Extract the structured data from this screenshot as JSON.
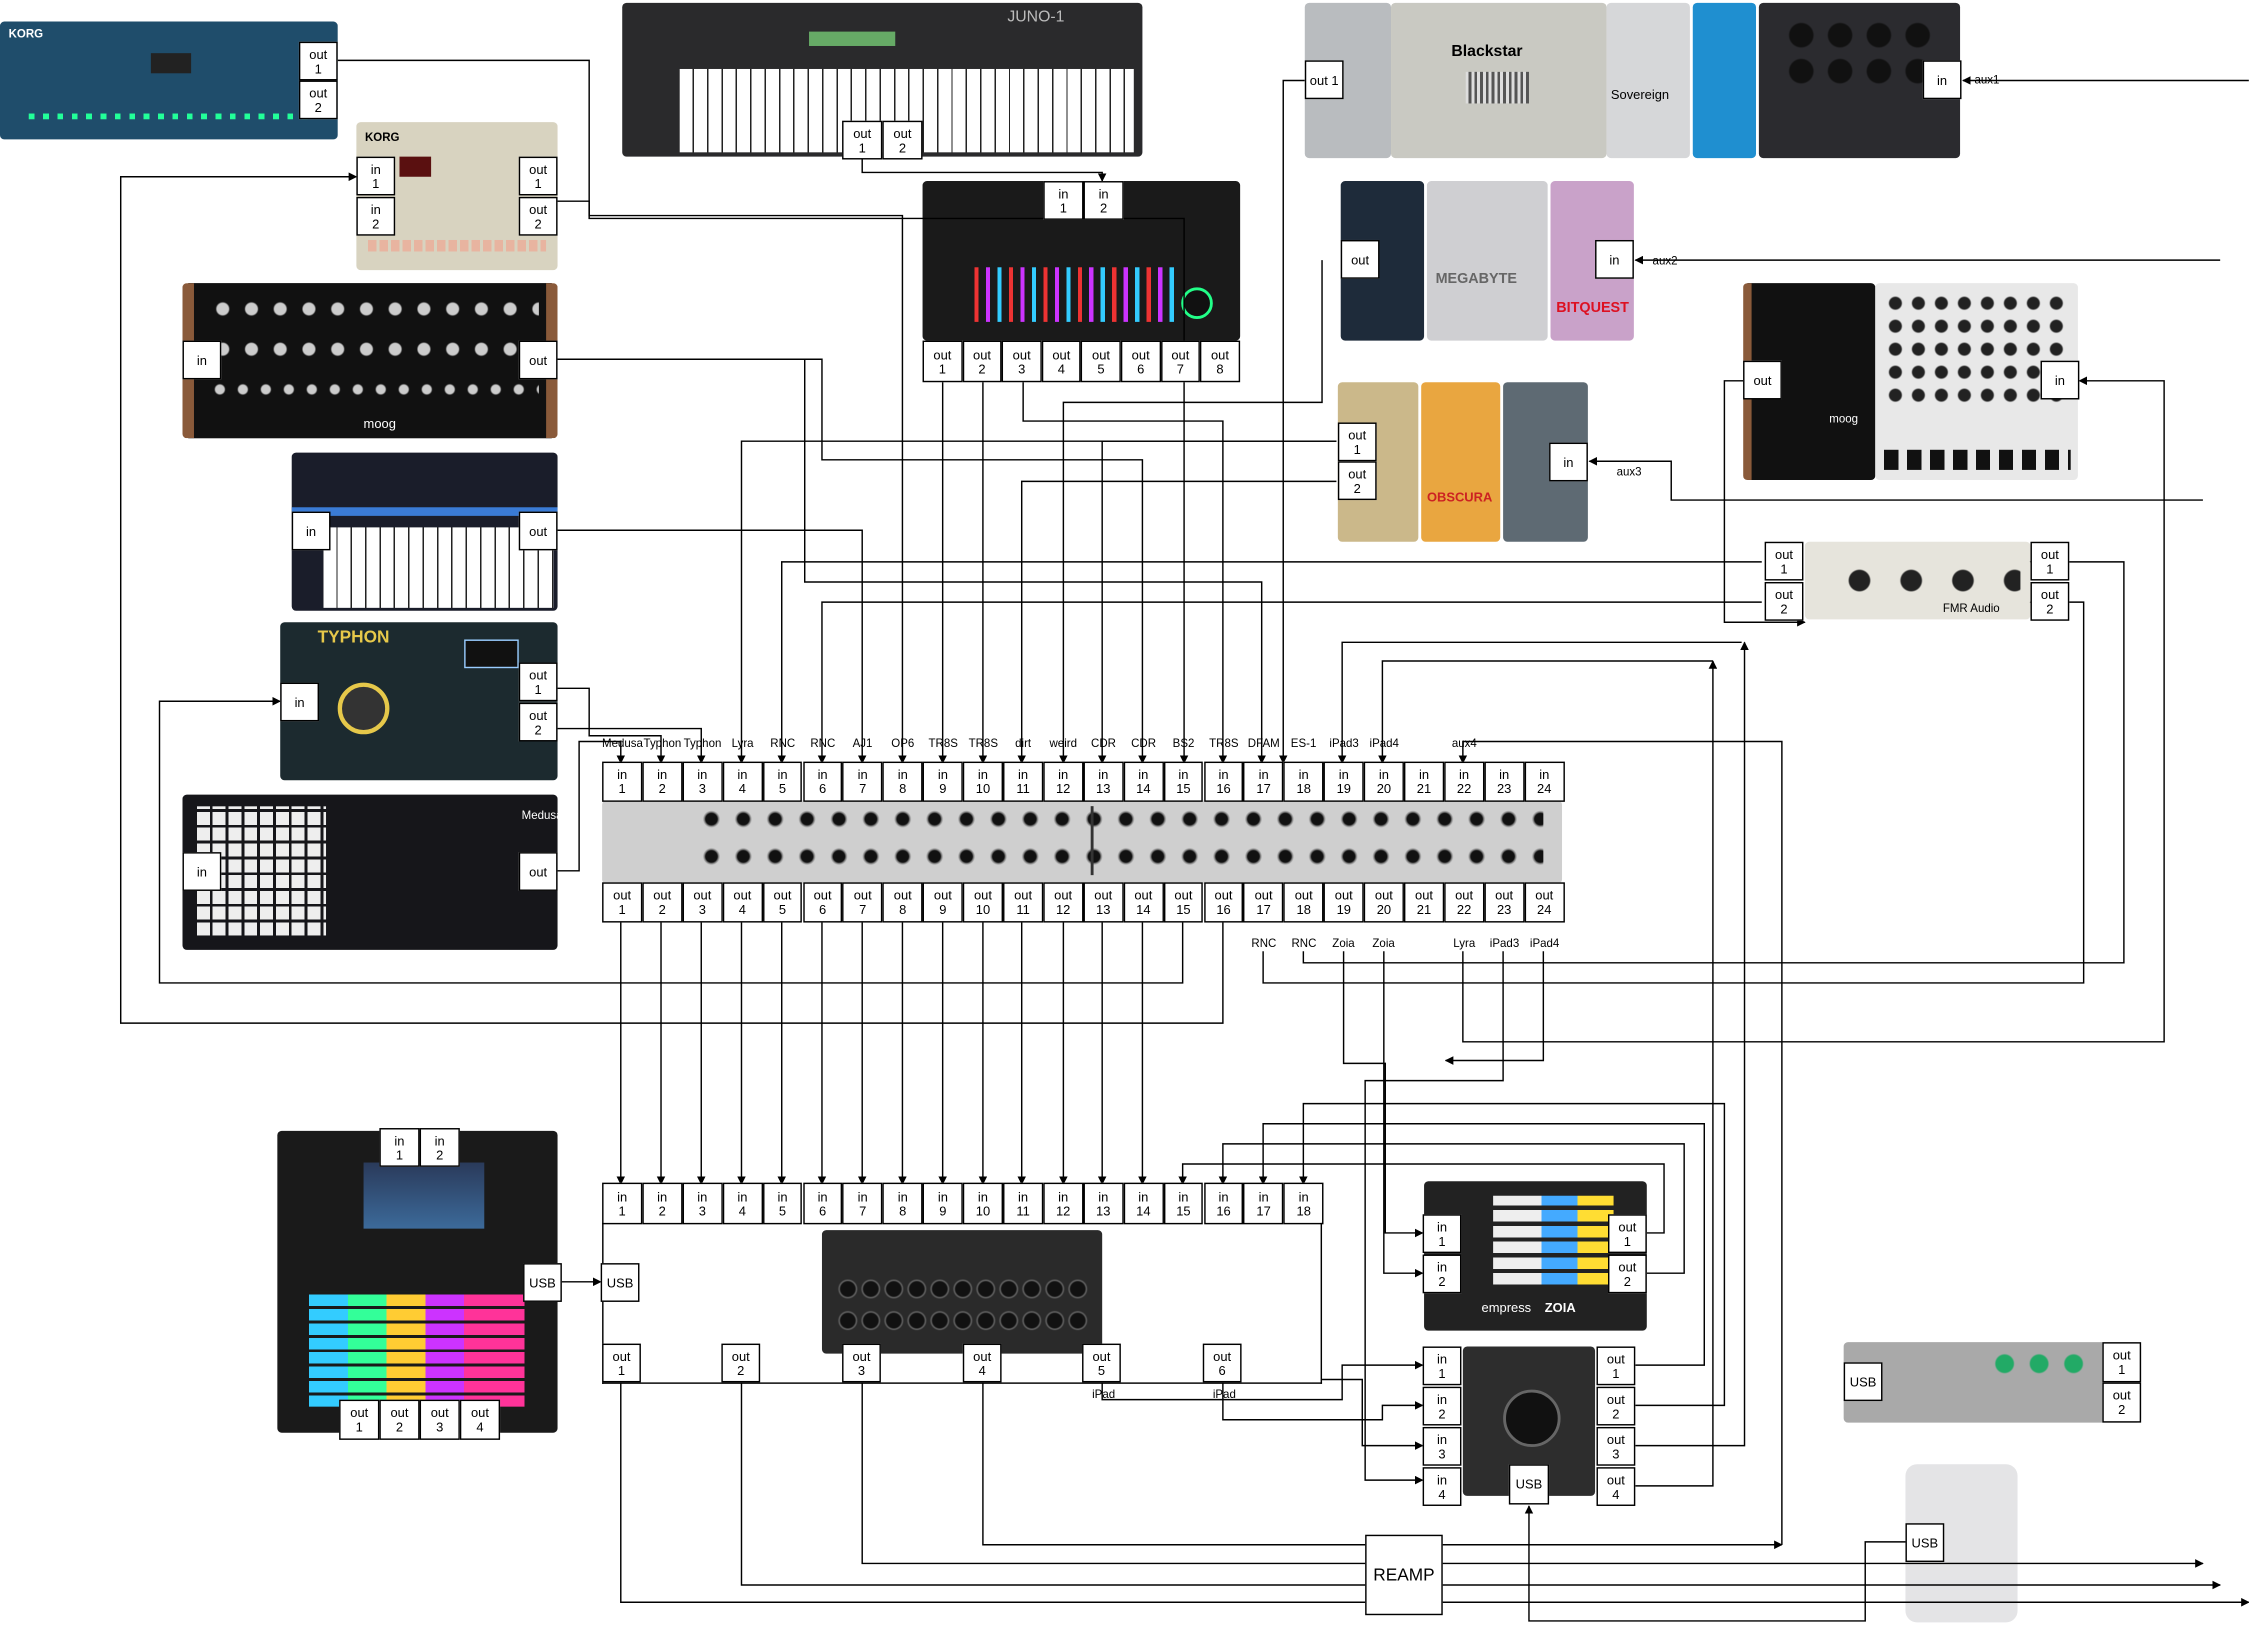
{
  "patchbay_top_labels": [
    "Medusa",
    "Typhon",
    "Typhon",
    "Lyra",
    "RNC",
    "RNC",
    "AJ1",
    "OP6",
    "TR8S",
    "TR8S",
    "dirt",
    "weird",
    "CDR",
    "CDR",
    "BS2",
    "TR8S",
    "DFAM",
    "ES-1",
    "iPad3",
    "iPad4",
    "",
    "aux4",
    "",
    ""
  ],
  "patchbay_bottom_labels": [
    "",
    "",
    "",
    "",
    "",
    "",
    "",
    "",
    "",
    "",
    "",
    "",
    "",
    "",
    "",
    "",
    "RNC",
    "RNC",
    "Zoia",
    "Zoia",
    "",
    "Lyra",
    "iPad3",
    "iPad4"
  ],
  "patchbay_in_prefix": "in",
  "patchbay_out_prefix": "out",
  "aux_labels": {
    "aux1": "aux1",
    "aux2": "aux2",
    "aux3": "aux3"
  },
  "mixer_ipad_labels": [
    "iPad",
    "iPad"
  ],
  "reamp_label": "REAMP",
  "usb_label": "USB",
  "ports": {
    "in": "in",
    "out": "out",
    "in1": "in\n1",
    "in2": "in\n2",
    "in3": "in\n3",
    "in4": "in\n4",
    "out1": "out\n1",
    "out2": "out\n2",
    "out3": "out\n3",
    "out4": "out\n4",
    "out5": "out\n5",
    "out6": "out\n6",
    "out7": "out\n7",
    "out8": "out\n8",
    "out_1": "out 1"
  },
  "device_brand_text": {
    "korg_volca": "KORG",
    "juno": "JUNO-1",
    "blackstar": "Blackstar",
    "sovereign": "Sovereign",
    "megabyte": "MEGABYTE",
    "bitquest": "BITQUEST",
    "obscura": "OBSCURA",
    "typhon": "TYPHON",
    "medusa": "Medusa",
    "moog": "moog",
    "moog_dfam": "moog",
    "zoia": "ZOIA",
    "empress": "empress",
    "fmr": "FMR Audio"
  }
}
